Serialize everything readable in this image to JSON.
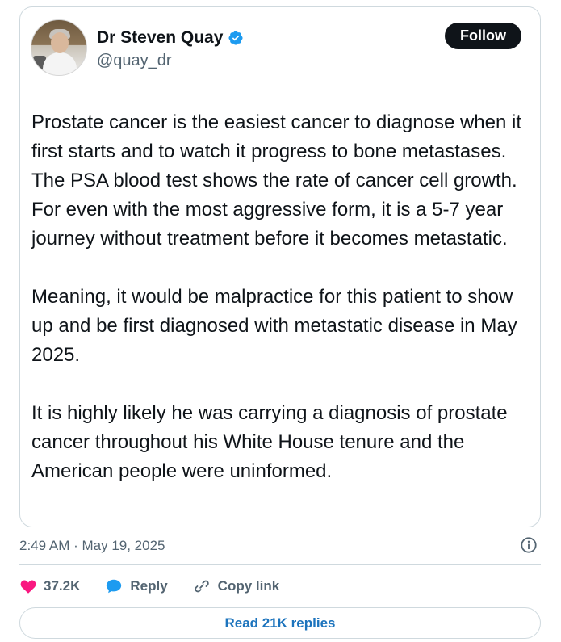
{
  "author": {
    "name": "Dr Steven Quay",
    "handle": "@quay_dr",
    "verified": true,
    "verified_icon": "verified-badge-icon",
    "verified_color": "#1d9bf0"
  },
  "follow_label": "Follow",
  "tweet": {
    "paragraphs": [
      "Prostate cancer is the easiest cancer to diagnose when it first starts and to watch it progress to bone metastases. The PSA blood test shows the rate of cancer cell growth. For even with the most aggressive form, it is a 5-7 year journey without treatment before it becomes metastatic.",
      "Meaning, it would be malpractice for this patient to show up and be first diagnosed with metastatic disease in May 2025.",
      "It is highly likely he was carrying a diagnosis of prostate cancer throughout his White House tenure and the American people were uninformed."
    ]
  },
  "timestamp": "2:49 AM · May 19, 2025",
  "actions": {
    "like_count": "37.2K",
    "like_color": "#f91880",
    "reply_label": "Reply",
    "reply_color": "#1d9bf0",
    "copy_link_label": "Copy link"
  },
  "read_replies_label": "Read 21K replies",
  "colors": {
    "text": "#0f1419",
    "secondary": "#536471",
    "border": "#cfd9de",
    "link_blue": "#1d74bd"
  }
}
